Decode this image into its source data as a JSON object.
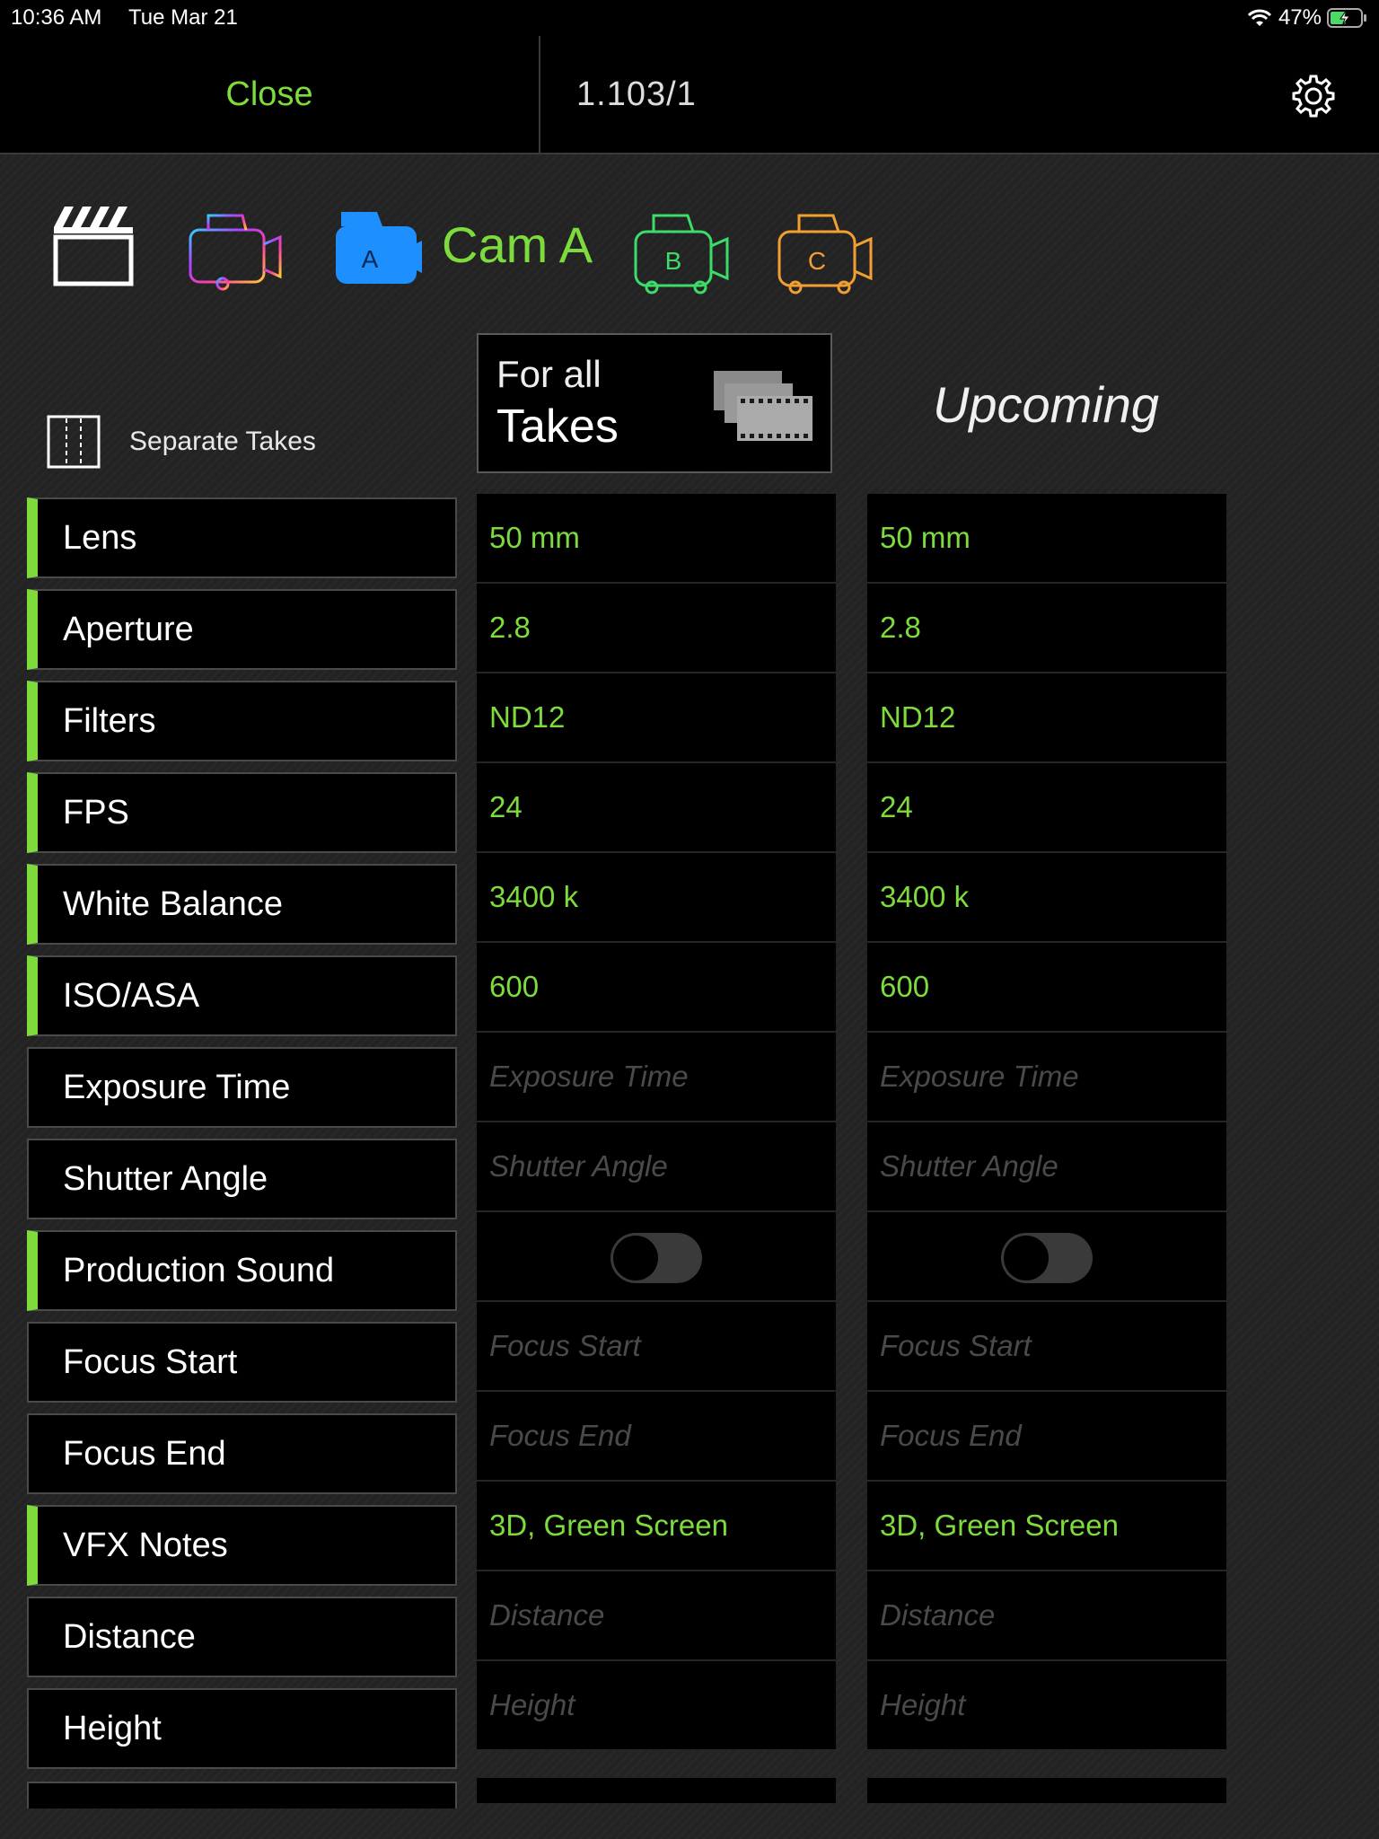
{
  "status": {
    "time": "10:36 AM",
    "date": "Tue Mar 21",
    "battery": "47%"
  },
  "nav": {
    "close_label": "Close",
    "title": "1.103/1"
  },
  "cameras": {
    "selected_label": "Cam A",
    "a_letter": "A",
    "b_letter": "B",
    "c_letter": "C"
  },
  "separate_takes_label": "Separate Takes",
  "for_all": {
    "line1": "For all",
    "line2": "Takes"
  },
  "upcoming_label": "Upcoming",
  "rows": [
    {
      "label": "Lens",
      "active": true,
      "value": "50 mm"
    },
    {
      "label": "Aperture",
      "active": true,
      "value": "2.8"
    },
    {
      "label": "Filters",
      "active": true,
      "value": "ND12"
    },
    {
      "label": "FPS",
      "active": true,
      "value": "24"
    },
    {
      "label": "White Balance",
      "active": true,
      "value": "3400 k"
    },
    {
      "label": "ISO/ASA",
      "active": true,
      "value": "600"
    },
    {
      "label": "Exposure Time",
      "active": false,
      "placeholder": "Exposure Time"
    },
    {
      "label": "Shutter Angle",
      "active": false,
      "placeholder": "Shutter Angle"
    },
    {
      "label": "Production Sound",
      "active": true,
      "toggle": false
    },
    {
      "label": "Focus Start",
      "active": false,
      "placeholder": "Focus Start"
    },
    {
      "label": "Focus End",
      "active": false,
      "placeholder": "Focus End"
    },
    {
      "label": "VFX Notes",
      "active": true,
      "value": "3D, Green Screen"
    },
    {
      "label": "Distance",
      "active": false,
      "placeholder": "Distance"
    },
    {
      "label": "Height",
      "active": false,
      "placeholder": "Height"
    }
  ],
  "colors": {
    "accent": "#7ddc3c",
    "cam_a": "#1e8fff",
    "cam_b": "#3ddc6a",
    "cam_c": "#f0a030"
  }
}
